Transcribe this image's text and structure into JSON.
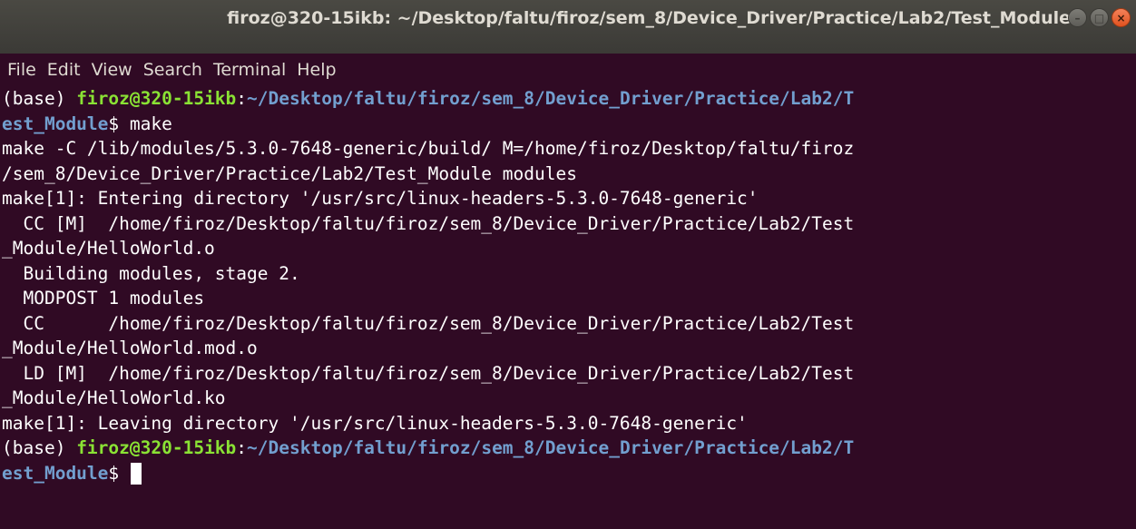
{
  "window": {
    "title": "firoz@320-15ikb: ~/Desktop/faltu/firoz/sem_8/Device_Driver/Practice/Lab2/Test_Module",
    "buttons": {
      "minimize": "–",
      "maximize": "□",
      "close": "×"
    }
  },
  "menu": {
    "items": [
      "File",
      "Edit",
      "View",
      "Search",
      "Terminal",
      "Help"
    ]
  },
  "colors": {
    "background": "#300a24",
    "prompt_user": "#8ae234",
    "prompt_path": "#729fcf",
    "text": "#ffffff"
  },
  "terminal": {
    "prompt1": {
      "env": "(base) ",
      "user": "firoz@320-15ikb",
      "sep": ":",
      "path_a": "~/Desktop/faltu/firoz/sem_8/Device_Driver/Practice/Lab2/T",
      "path_b": "est_Module",
      "symbol": "$ ",
      "command": "make"
    },
    "output": [
      "make -C /lib/modules/5.3.0-7648-generic/build/ M=/home/firoz/Desktop/faltu/firoz",
      "/sem_8/Device_Driver/Practice/Lab2/Test_Module modules",
      "make[1]: Entering directory '/usr/src/linux-headers-5.3.0-7648-generic'",
      "  CC [M]  /home/firoz/Desktop/faltu/firoz/sem_8/Device_Driver/Practice/Lab2/Test",
      "_Module/HelloWorld.o",
      "  Building modules, stage 2.",
      "  MODPOST 1 modules",
      "  CC      /home/firoz/Desktop/faltu/firoz/sem_8/Device_Driver/Practice/Lab2/Test",
      "_Module/HelloWorld.mod.o",
      "  LD [M]  /home/firoz/Desktop/faltu/firoz/sem_8/Device_Driver/Practice/Lab2/Test",
      "_Module/HelloWorld.ko",
      "make[1]: Leaving directory '/usr/src/linux-headers-5.3.0-7648-generic'"
    ],
    "prompt2": {
      "env": "(base) ",
      "user": "firoz@320-15ikb",
      "sep": ":",
      "path_a": "~/Desktop/faltu/firoz/sem_8/Device_Driver/Practice/Lab2/T",
      "path_b": "est_Module",
      "symbol": "$ "
    }
  }
}
